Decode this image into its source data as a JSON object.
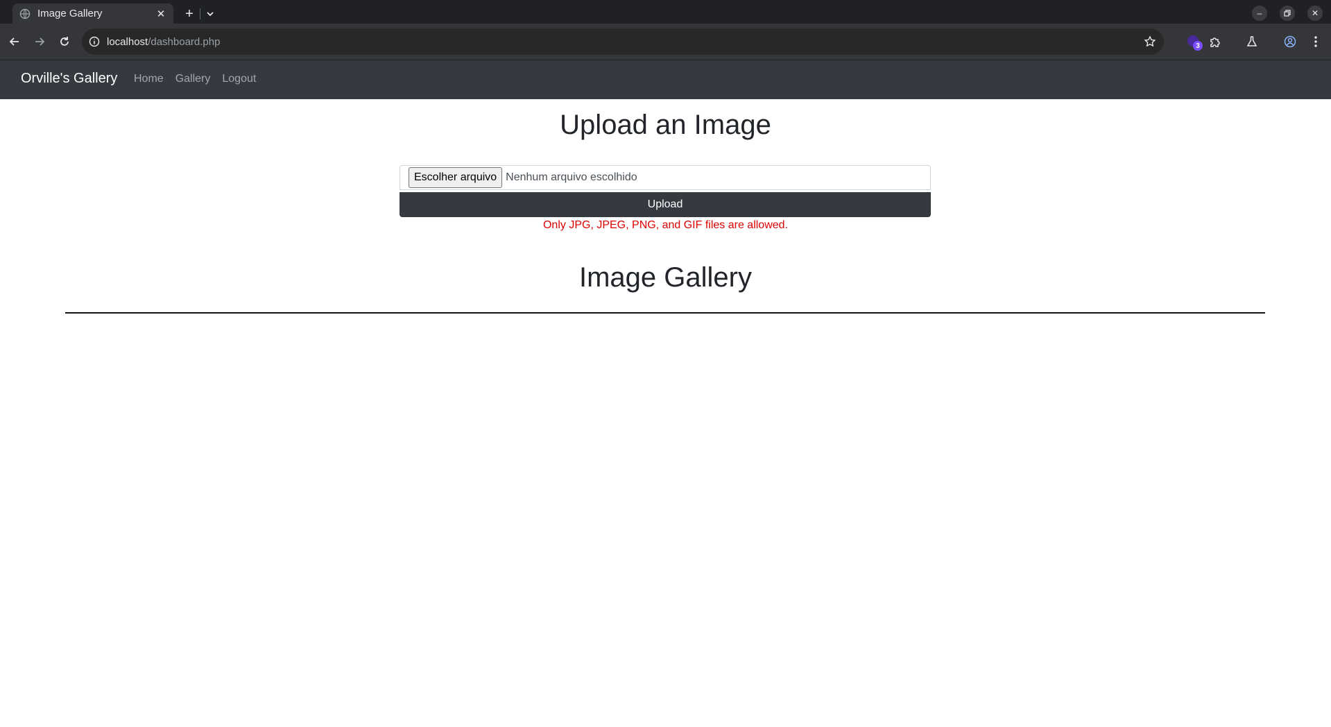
{
  "browser": {
    "tab_title": "Image Gallery",
    "url_host": "localhost",
    "url_path": "/dashboard.php",
    "extension_badge": "3"
  },
  "navbar": {
    "brand": "Orville's Gallery",
    "links": [
      "Home",
      "Gallery",
      "Logout"
    ]
  },
  "upload": {
    "title": "Upload an Image",
    "choose_label": "Escolher arquivo",
    "no_file_label": "Nenhum arquivo escolhido",
    "button_label": "Upload",
    "error": "Only JPG, JPEG, PNG, and GIF files are allowed."
  },
  "gallery": {
    "title": "Image Gallery"
  },
  "colors": {
    "navbar_bg": "#343a40",
    "error": "#dc0000"
  }
}
